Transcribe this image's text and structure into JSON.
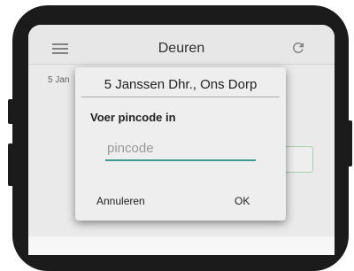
{
  "app": {
    "title": "Deuren",
    "menu_icon": "hamburger-menu-icon",
    "refresh_icon": "refresh-icon"
  },
  "list": {
    "first_item_date": "5 Jan"
  },
  "dialog": {
    "title": "5 Janssen Dhr., Ons Dorp",
    "prompt": "Voer pincode in",
    "input_placeholder": "pincode",
    "input_value": "",
    "cancel_label": "Annuleren",
    "ok_label": "OK"
  },
  "colors": {
    "phone_frame": "#1b1b1b",
    "accent_underline": "#3d9c87",
    "dialog_background": "#eeeeee"
  }
}
